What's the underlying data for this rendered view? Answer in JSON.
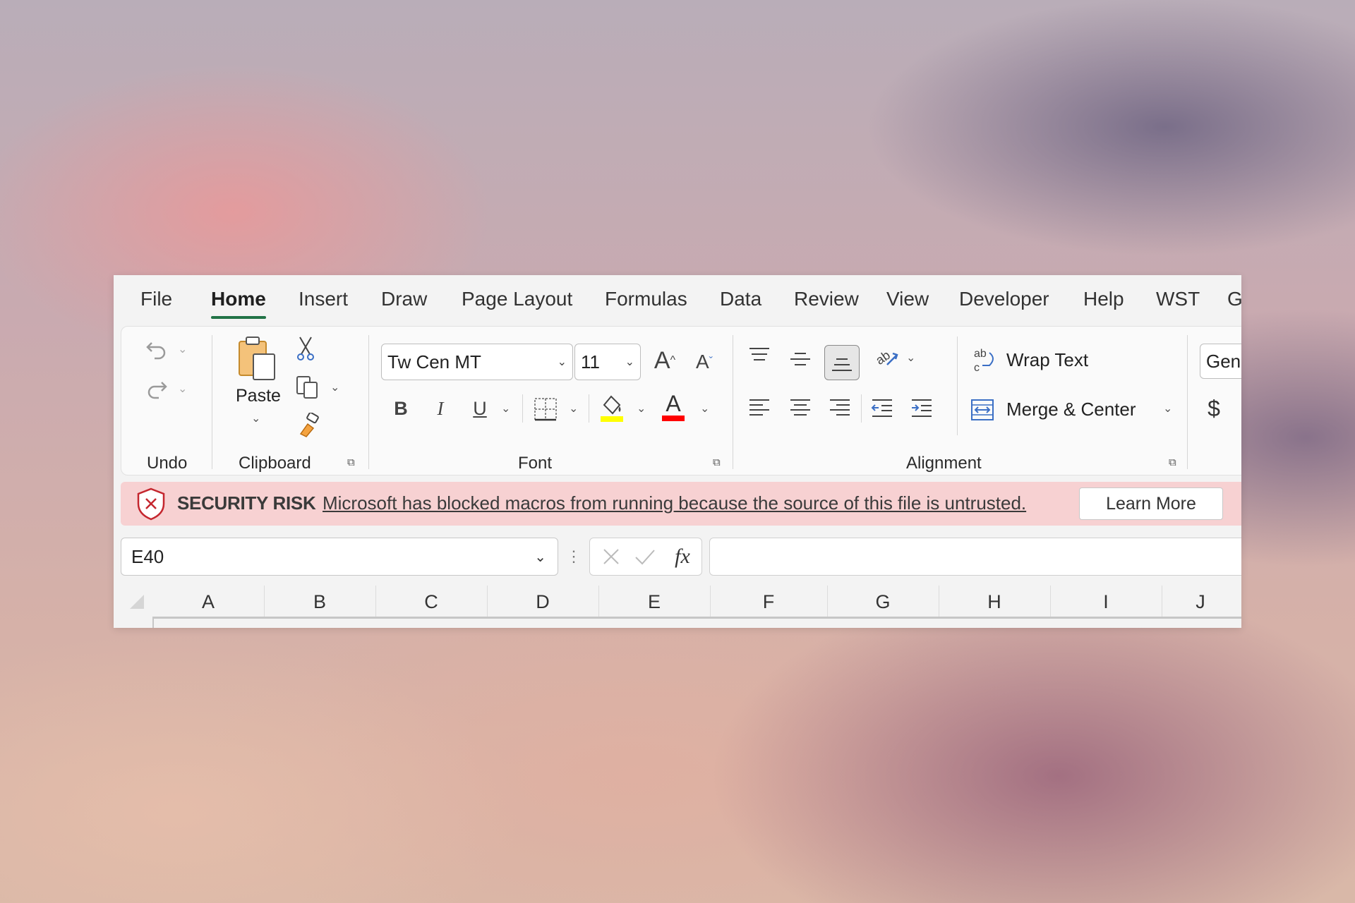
{
  "tabs": [
    "File",
    "Home",
    "Insert",
    "Draw",
    "Page Layout",
    "Formulas",
    "Data",
    "Review",
    "View",
    "Developer",
    "Help",
    "WST",
    "G"
  ],
  "active_tab": "Home",
  "ribbon": {
    "groups": {
      "undo": "Undo",
      "clipboard": "Clipboard",
      "font": "Font",
      "alignment": "Alignment"
    },
    "clipboard": {
      "paste_label": "Paste"
    },
    "font": {
      "name": "Tw Cen MT",
      "size": "11",
      "bold": "B",
      "italic": "I",
      "underline": "U"
    },
    "alignment": {
      "wrap_text": "Wrap Text",
      "merge_center": "Merge & Center"
    },
    "number": {
      "format": "Gene",
      "currency": "$"
    }
  },
  "colors": {
    "accent": "#217346",
    "highlight": "#ffff00",
    "font_color": "#ff0000",
    "banner_bg": "#f7d1d2"
  },
  "banner": {
    "title": "SECURITY RISK",
    "message": "Microsoft has blocked macros from running because the source of this file is untrusted.",
    "button": "Learn More"
  },
  "formula_bar": {
    "cell_ref": "E40",
    "fx_label": "fx",
    "value": ""
  },
  "columns": [
    "A",
    "B",
    "C",
    "D",
    "E",
    "F",
    "G",
    "H",
    "I",
    "J"
  ]
}
